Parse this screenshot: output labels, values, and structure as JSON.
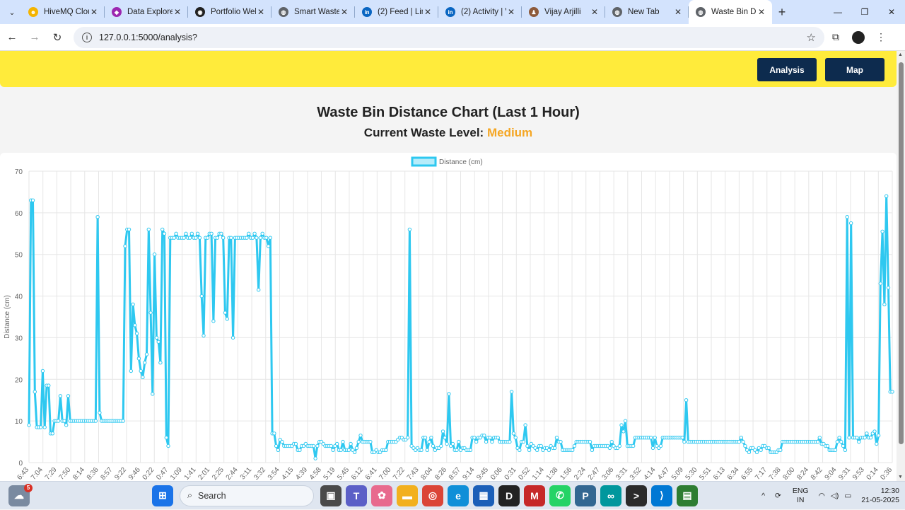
{
  "browser": {
    "tabs": [
      {
        "title": "HiveMQ Clou",
        "color": "#f4b400",
        "glyph": "☻"
      },
      {
        "title": "Data Explore",
        "color": "#9c27b0",
        "glyph": "◆"
      },
      {
        "title": "Portfolio Web",
        "color": "#222222",
        "glyph": "◉"
      },
      {
        "title": "Smart Waste",
        "color": "#5f6368",
        "glyph": "◍"
      },
      {
        "title": "(2) Feed | Link",
        "color": "#0a66c2",
        "glyph": "in"
      },
      {
        "title": "(2) Activity | V",
        "color": "#0a66c2",
        "glyph": "in"
      },
      {
        "title": "Vijay Arjilli",
        "color": "#8d5a3b",
        "glyph": "♟"
      },
      {
        "title": "New Tab",
        "color": "#5f6368",
        "glyph": "◍"
      },
      {
        "title": "Waste Bin Di",
        "color": "#5f6368",
        "glyph": "◍",
        "active": true
      }
    ],
    "url": "127.0.0.1:5000/analysis?"
  },
  "navbar": {
    "analysis_label": "Analysis",
    "map_label": "Map"
  },
  "page": {
    "title": "Waste Bin Distance Chart (Last 1 Hour)",
    "level_prefix": "Current Waste Level:",
    "level_value": "Medium",
    "level_color": "#f5a623"
  },
  "chart_data": {
    "type": "line",
    "ylabel": "Distance (cm)",
    "ylim": [
      0,
      70
    ],
    "yticks": [
      0,
      10,
      20,
      30,
      40,
      50,
      60,
      70
    ],
    "series": [
      {
        "name": "Distance (cm)",
        "color": "#2ec8f0",
        "values": [
          9,
          63,
          63,
          17,
          8.5,
          8.5,
          8.5,
          22,
          8.5,
          18.5,
          18.5,
          7,
          7,
          10,
          10,
          10,
          16,
          10,
          10,
          9,
          16,
          10,
          10,
          10,
          10,
          10,
          10,
          10,
          10,
          10,
          10,
          10,
          10,
          10,
          10,
          59,
          12,
          10,
          10,
          10,
          10,
          10,
          10,
          10,
          10,
          10,
          10,
          10,
          10,
          52,
          56,
          56,
          22,
          38,
          33,
          31,
          25,
          22,
          20.5,
          24,
          26,
          56,
          36,
          16.5,
          50,
          30,
          29,
          24,
          56,
          55,
          6,
          4,
          54,
          54,
          54,
          55,
          54,
          54,
          54,
          54,
          55,
          54,
          54,
          55,
          54,
          54,
          55,
          54,
          40,
          30.5,
          54,
          54,
          55,
          55,
          34,
          54,
          54,
          55,
          55,
          54,
          36,
          34.5,
          54,
          54,
          30,
          54,
          54,
          54,
          54,
          54,
          54,
          54,
          55,
          54,
          54,
          55,
          54,
          41.5,
          54,
          55,
          54,
          54,
          52,
          54,
          7,
          7,
          4,
          3,
          5.5,
          5,
          4,
          4,
          4,
          4,
          4,
          4.5,
          4.5,
          3,
          3,
          4,
          4,
          4.5,
          4,
          4,
          4,
          4,
          1,
          4,
          5,
          5,
          4.5,
          4,
          4,
          4,
          4,
          3,
          4,
          4.5,
          3,
          3,
          5,
          3,
          3,
          3,
          4.5,
          3,
          2.5,
          3.5,
          5,
          6.5,
          5,
          5,
          5,
          5,
          5,
          2.5,
          2.5,
          3,
          2.5,
          2.5,
          3,
          3,
          3,
          5,
          5,
          5,
          5,
          5,
          5.5,
          6,
          6,
          5.5,
          5.5,
          6,
          56,
          4,
          3.5,
          3,
          3.5,
          3,
          3,
          6,
          6,
          3,
          5,
          6,
          4,
          3,
          3.5,
          3.5,
          4,
          7.5,
          6,
          4.5,
          16.5,
          4,
          4.5,
          3,
          3,
          5,
          3,
          3.5,
          3.5,
          3,
          3,
          3,
          6,
          6,
          5,
          6,
          6,
          6.5,
          6.5,
          5,
          6,
          6,
          5,
          6,
          6,
          6,
          5,
          5,
          5,
          5,
          5,
          5,
          17,
          7,
          6,
          3.5,
          3,
          5,
          5,
          9,
          4,
          3,
          4.5,
          4,
          3.5,
          3,
          4,
          4,
          3,
          3.5,
          3.5,
          3,
          4,
          3.5,
          3.5,
          6,
          5,
          5,
          3,
          3,
          3,
          3,
          3,
          3,
          4,
          5,
          5,
          5,
          5,
          5,
          5,
          5,
          5,
          3,
          4,
          4,
          4,
          4,
          4,
          4,
          4,
          4,
          3.5,
          5,
          4,
          3.5,
          3.5,
          4,
          9,
          7.5,
          10,
          4,
          4,
          4,
          4,
          6,
          6,
          6,
          6,
          6,
          6,
          6,
          6,
          6,
          3.5,
          6,
          4,
          3.5,
          4,
          6,
          6,
          6,
          6,
          6,
          6,
          6,
          6,
          6,
          6,
          6,
          5,
          15,
          5,
          5,
          5,
          5,
          5,
          5,
          5,
          5,
          5,
          5,
          5,
          5,
          5,
          5,
          5,
          5,
          5,
          5,
          5,
          5,
          5,
          5,
          5,
          5,
          5,
          5,
          5,
          6,
          5,
          4,
          3,
          2.5,
          3.5,
          3.5,
          3,
          2.5,
          3.5,
          3,
          4,
          4,
          3.5,
          3.5,
          2.5,
          2.5,
          2.5,
          2.5,
          3,
          3,
          5,
          5,
          5,
          5,
          5,
          5,
          5,
          5,
          5,
          5,
          5,
          5,
          5,
          5,
          5,
          5,
          5,
          5,
          5,
          6,
          4.5,
          4.5,
          4,
          4,
          3,
          3,
          3,
          3,
          5,
          6,
          5,
          4,
          3,
          59,
          6,
          57.5,
          6,
          6,
          6,
          5,
          6,
          6,
          6,
          7,
          6,
          6,
          7,
          7.5,
          4.5,
          6.5,
          43,
          55.5,
          38,
          64,
          42,
          17,
          17
        ]
      }
    ],
    "x_tick_labels": [
      "6:43",
      "7:04",
      "7:29",
      "7:50",
      "8:14",
      "8:36",
      "8:57",
      "9:22",
      "9:46",
      "0:22",
      "0:47",
      "1:09",
      "1:41",
      "2:01",
      "2:25",
      "2:44",
      "3:11",
      "3:32",
      "3:54",
      "4:15",
      "4:39",
      "4:58",
      "5:19",
      "5:45",
      "6:12",
      "6:41",
      "7:00",
      "7:22",
      "7:43",
      "8:04",
      "8:26",
      "8:57",
      "9:14",
      "9:45",
      "0:06",
      "0:31",
      "0:52",
      "1:14",
      "1:38",
      "1:56",
      "2:24",
      "2:47",
      "3:06",
      "3:31",
      "3:52",
      "4:14",
      "4:47",
      "5:09",
      "5:30",
      "5:51",
      "6:13",
      "6:34",
      "6:55",
      "7:17",
      "7:38",
      "8:00",
      "8:24",
      "8:42",
      "9:04",
      "9:31",
      "9:53",
      "0:14",
      "0:36"
    ],
    "grid": true,
    "legend": "top-center"
  },
  "taskbar": {
    "search_placeholder": "Search",
    "notif_badge": "5",
    "lang_top": "ENG",
    "lang_bottom": "IN",
    "time": "12:30",
    "date": "21-05-2025"
  }
}
